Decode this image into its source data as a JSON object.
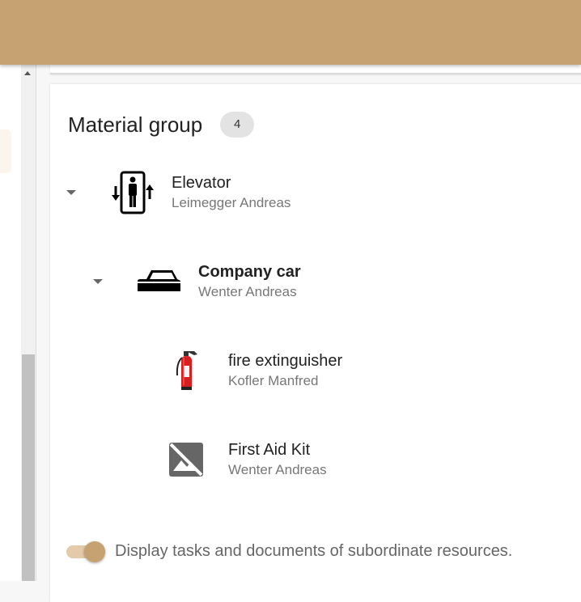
{
  "colors": {
    "topbar": "#c6a171",
    "toggle_track": "#e4caa8",
    "toggle_knob": "#c6a171",
    "badge_bg": "#e3e3e3"
  },
  "material_group": {
    "title": "Material group",
    "count": "4",
    "items": [
      {
        "name": "Elevator",
        "owner": "Leimegger Andreas",
        "icon": "elevator-icon",
        "expanded": true
      },
      {
        "name": "Company car",
        "owner": "Wenter Andreas",
        "icon": "car-icon",
        "expanded": true
      },
      {
        "name": "fire extinguisher",
        "owner": "Kofler Manfred",
        "icon": "fire-extinguisher-icon"
      },
      {
        "name": "First Aid Kit",
        "owner": "Wenter Andreas",
        "icon": "image-placeholder-icon"
      }
    ]
  },
  "toggle": {
    "label": "Display tasks and documents of subordinate resources.",
    "checked": true
  }
}
